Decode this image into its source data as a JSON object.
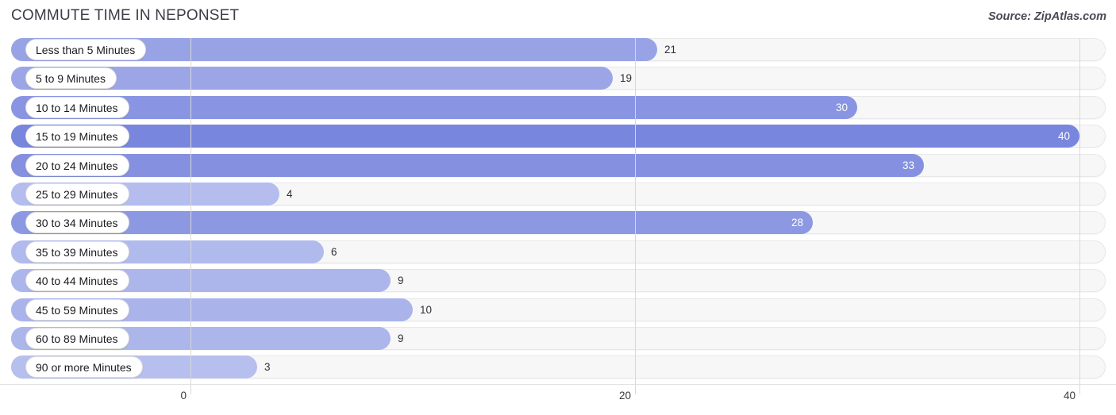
{
  "header": {
    "title": "COMMUTE TIME IN NEPONSET",
    "source": "Source: ZipAtlas.com"
  },
  "colors": {
    "bar_min": "#b6bfee",
    "bar_max": "#7986dd",
    "track": "#f7f7f7",
    "gridline": "#d8d8d8",
    "label_text": "#1b1b20",
    "value_text_outside": "#30303a",
    "value_text_inside": "#ffffff",
    "title_text": "#3c3c47"
  },
  "chart_data": {
    "type": "bar",
    "orientation": "horizontal",
    "title": "COMMUTE TIME IN NEPONSET",
    "xlabel": "",
    "ylabel": "",
    "xlim": [
      0,
      40
    ],
    "grid": true,
    "legend": "none",
    "xticks": [
      {
        "label": "0",
        "value": 0
      },
      {
        "label": "20",
        "value": 20
      },
      {
        "label": "40",
        "value": 40
      }
    ],
    "categories": [
      "Less than 5 Minutes",
      "5 to 9 Minutes",
      "10 to 14 Minutes",
      "15 to 19 Minutes",
      "20 to 24 Minutes",
      "25 to 29 Minutes",
      "30 to 34 Minutes",
      "35 to 39 Minutes",
      "40 to 44 Minutes",
      "45 to 59 Minutes",
      "60 to 89 Minutes",
      "90 or more Minutes"
    ],
    "values": [
      21,
      19,
      30,
      40,
      33,
      4,
      28,
      6,
      9,
      10,
      9,
      3
    ],
    "value_labels": [
      "21",
      "19",
      "30",
      "40",
      "33",
      "4",
      "28",
      "6",
      "9",
      "10",
      "9",
      "3"
    ],
    "bars": [
      {
        "category": "Less than 5 Minutes",
        "value": 21,
        "label": "21",
        "label_inside": false
      },
      {
        "category": "5 to 9 Minutes",
        "value": 19,
        "label": "19",
        "label_inside": false
      },
      {
        "category": "10 to 14 Minutes",
        "value": 30,
        "label": "30",
        "label_inside": true
      },
      {
        "category": "15 to 19 Minutes",
        "value": 40,
        "label": "40",
        "label_inside": true
      },
      {
        "category": "20 to 24 Minutes",
        "value": 33,
        "label": "33",
        "label_inside": true
      },
      {
        "category": "25 to 29 Minutes",
        "value": 4,
        "label": "4",
        "label_inside": false
      },
      {
        "category": "30 to 34 Minutes",
        "value": 28,
        "label": "28",
        "label_inside": true
      },
      {
        "category": "35 to 39 Minutes",
        "value": 6,
        "label": "6",
        "label_inside": false
      },
      {
        "category": "40 to 44 Minutes",
        "value": 9,
        "label": "9",
        "label_inside": false
      },
      {
        "category": "45 to 59 Minutes",
        "value": 10,
        "label": "10",
        "label_inside": false
      },
      {
        "category": "60 to 89 Minutes",
        "value": 9,
        "label": "9",
        "label_inside": false
      },
      {
        "category": "90 or more Minutes",
        "value": 3,
        "label": "3",
        "label_inside": false
      }
    ]
  }
}
